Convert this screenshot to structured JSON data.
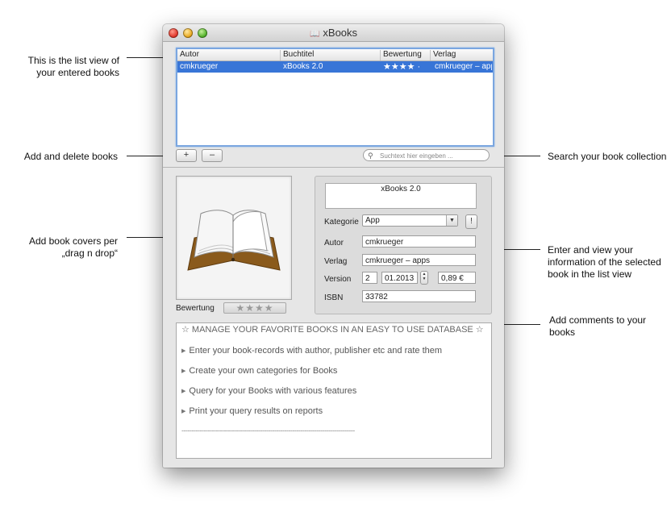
{
  "window": {
    "title": "xBooks"
  },
  "table": {
    "columns": [
      "Autor",
      "Buchtitel",
      "Bewertung",
      "Verlag"
    ],
    "rows": [
      {
        "autor": "cmkrueger",
        "buchtitel": "xBooks 2.0",
        "bewertung": "★★★★ ·",
        "verlag": "cmkrueger – apps"
      }
    ]
  },
  "toolbar": {
    "add_label": "+",
    "remove_label": "–"
  },
  "search": {
    "placeholder": "Suchtext hier eingeben ..."
  },
  "cover": {
    "rating_label": "Bewertung",
    "rating_stars": "★★★★"
  },
  "details": {
    "title_value": "xBooks 2.0",
    "kategorie_label": "Kategorie",
    "kategorie_value": "App",
    "excl_label": "!",
    "autor_label": "Autor",
    "autor_value": "cmkrueger",
    "verlag_label": "Verlag",
    "verlag_value": "cmkrueger – apps",
    "version_label": "Version",
    "version_value": "2",
    "date_value": "01.2013",
    "price_value": "0,89 €",
    "isbn_label": "ISBN",
    "isbn_value": "33782"
  },
  "comments": {
    "lines": [
      "☆ MANAGE YOUR FAVORITE BOOKS IN AN EASY TO USE DATABASE ☆",
      "Enter your book-records with author, publisher etc and rate them",
      "Create your own categories for Books",
      "Query for your Books with various features",
      "Print your query results on reports",
      "--------------------------------------------------------------------------------------"
    ]
  },
  "callouts": {
    "list_view": "This is the list view of your entered books",
    "add_delete": "Add and delete books",
    "covers": "Add book covers per „drag n drop“",
    "search": "Search your book collection",
    "enter_view": "Enter and view your information of the selected book in the list view",
    "comments": "Add comments to your books"
  },
  "colors": {
    "selection": "#3875d7",
    "focus_ring": "#7aa6e0",
    "window_bg": "#e6e6e6"
  }
}
